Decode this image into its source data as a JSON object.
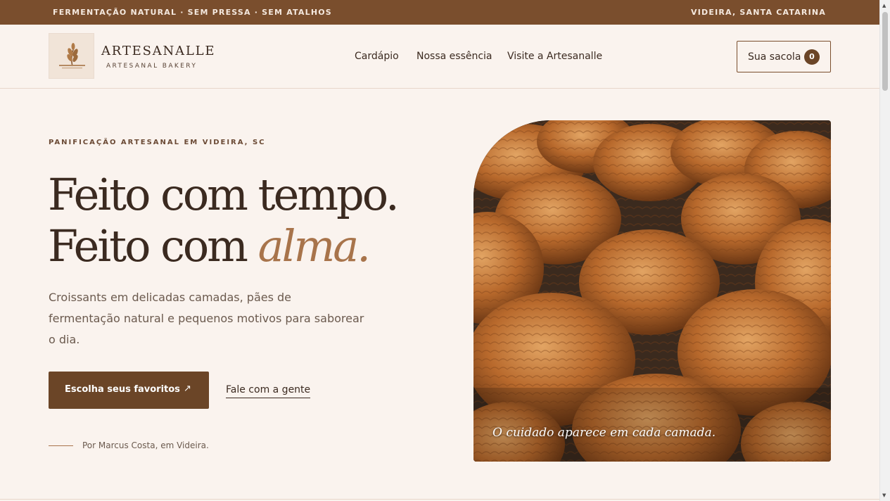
{
  "topbar": {
    "left_text": "FERMENTAÇÃO NATURAL · SEM PRESSA · SEM ATALHOS",
    "right_text": "VIDEIRA, SANTA CATARINA"
  },
  "header": {
    "logo_icon": "wheat-logo-icon",
    "brand_name": "ARTESANALLE",
    "brand_sub": "ARTESANAL BAKERY",
    "nav": [
      "Cardápio",
      "Nossa essência",
      "Visite a Artesanalle"
    ],
    "bag_label": "Sua sacola",
    "bag_count": "0"
  },
  "hero": {
    "eyebrow": "PANIFICAÇÃO ARTESANAL EM VIDEIRA, SC",
    "title_line1": "Feito com tempo.",
    "title_line2_prefix": "Feito com ",
    "title_line2_accent": "alma.",
    "lead": "Croissants em delicadas camadas, pães de fermentação natural e pequenos motivos para saborear o dia.",
    "cta_label": "Escolha seus favoritos",
    "cta_icon": "↗",
    "secondary_link": "Fale com a gente",
    "byline": "Por Marcus Costa, em Videira.",
    "photo_caption": "O cuidado aparece em cada camada."
  },
  "colors": {
    "brand_brown": "#7a4e2d",
    "cta_brown": "#6b4527",
    "accent": "#a8744b",
    "background": "#faf3ee"
  }
}
